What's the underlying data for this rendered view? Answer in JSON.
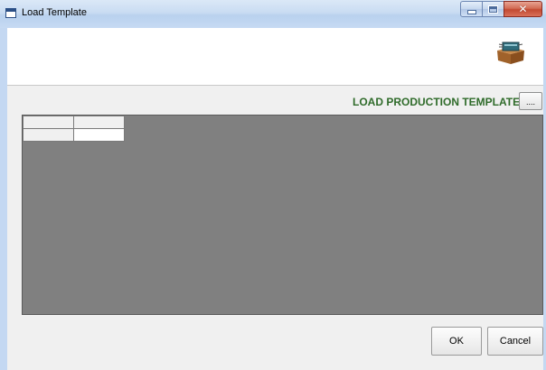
{
  "window": {
    "title": "Load Template"
  },
  "controls": {
    "close_glyph": "✕"
  },
  "header": {
    "icon": "package-box-icon"
  },
  "section": {
    "label": "LOAD PRODUCTION TEMPLATE",
    "browse_label": "...."
  },
  "grid": {
    "columns": [
      "",
      ""
    ],
    "rows": [
      [
        "",
        ""
      ]
    ]
  },
  "buttons": {
    "ok": "OK",
    "cancel": "Cancel"
  },
  "colors": {
    "section_label": "#2f6b2a",
    "grid_background": "#808080",
    "titlebar": "#c9dcf2"
  }
}
